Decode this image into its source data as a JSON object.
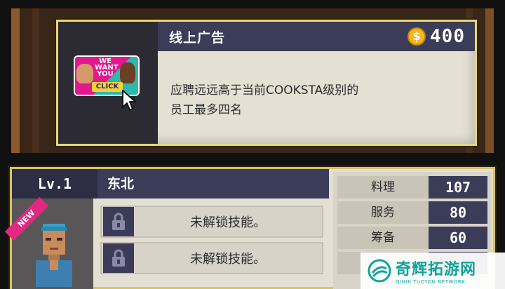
{
  "ad": {
    "title": "线上广告",
    "coin_icon": "coin-icon",
    "coin_symbol": "$",
    "cost": "400",
    "thumb_text": "WE WANT YOU",
    "thumb_button": "CLICK",
    "description_line1": "应聘远远高于当前COOKSTA级别的",
    "description_line2": "员工最多四名"
  },
  "employee": {
    "level": "Lv.1",
    "name": "东北",
    "badge": "NEW",
    "skills": [
      {
        "label": "未解锁技能。",
        "locked": true
      },
      {
        "label": "未解锁技能。",
        "locked": true
      }
    ],
    "stats": [
      {
        "label": "料理",
        "value": "107"
      },
      {
        "label": "服务",
        "value": "80"
      },
      {
        "label": "筹备",
        "value": "60"
      }
    ]
  },
  "watermark": {
    "main": "奇辉拓游网",
    "sub": "QIHUI TUOYOU NETWORK"
  },
  "colors": {
    "header_navy": "#3b3c58",
    "card_border_gold": "#e8d772",
    "new_badge_pink": "#e2287f",
    "coin_gold": "#f3b81e"
  }
}
